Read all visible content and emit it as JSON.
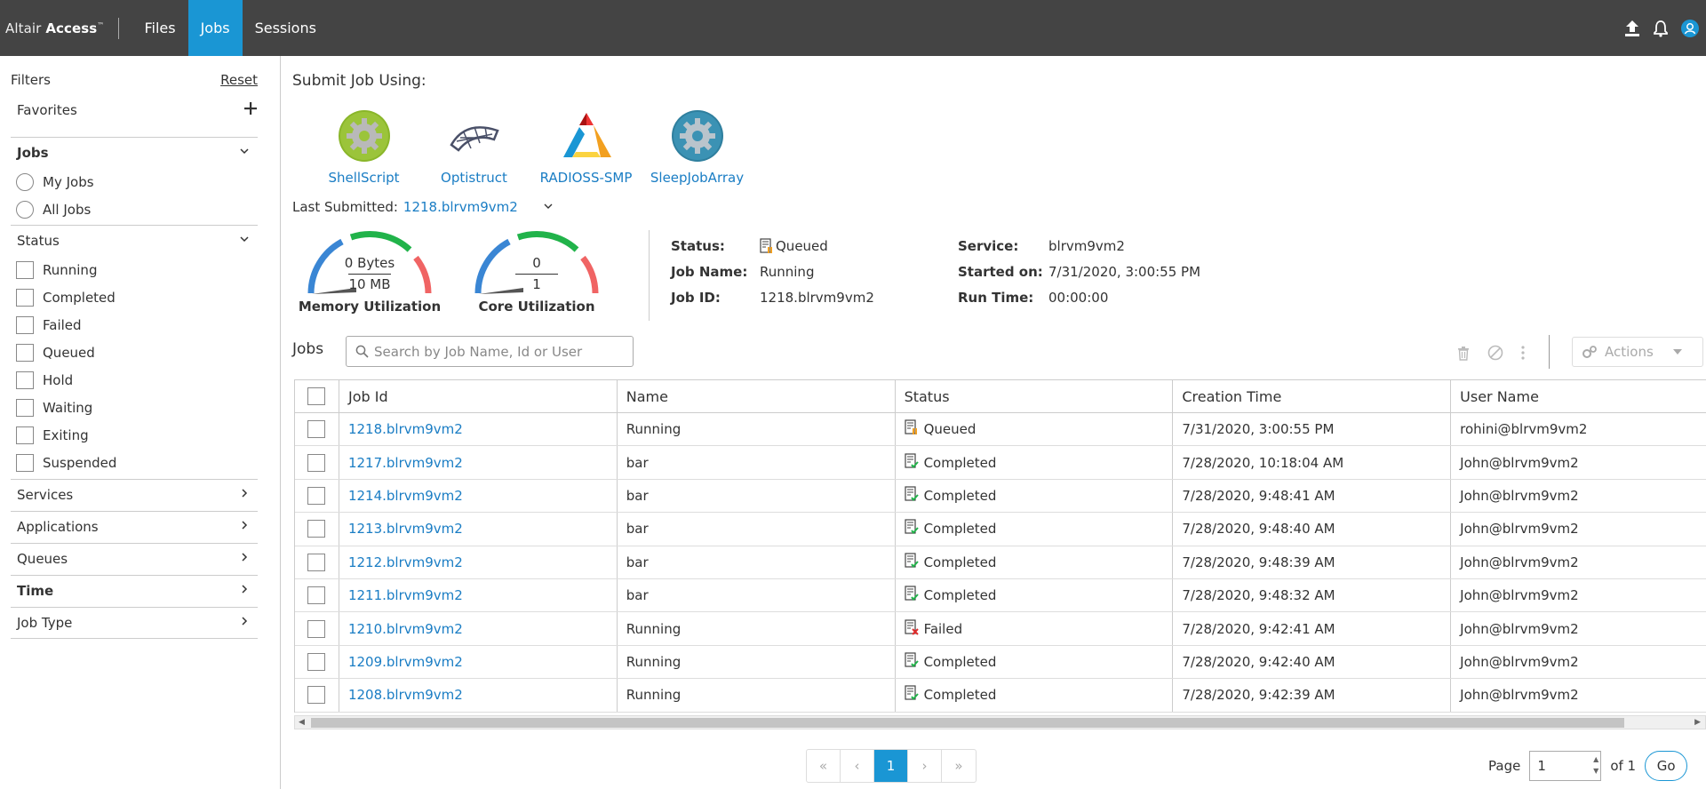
{
  "header": {
    "brand_prefix": "Altair",
    "brand_name": "Access",
    "brand_tm": "™",
    "tabs": [
      {
        "label": "Files",
        "active": false
      },
      {
        "label": "Jobs",
        "active": true
      },
      {
        "label": "Sessions",
        "active": false
      }
    ],
    "accent": "#1a96d4"
  },
  "sidebar": {
    "filters_label": "Filters",
    "reset_label": "Reset",
    "favorites_label": "Favorites",
    "jobs_section": {
      "label": "Jobs",
      "options": [
        "My Jobs",
        "All Jobs"
      ]
    },
    "status_section": {
      "label": "Status",
      "options": [
        "Running",
        "Completed",
        "Failed",
        "Queued",
        "Hold",
        "Waiting",
        "Exiting",
        "Suspended"
      ]
    },
    "collapsed_sections": [
      "Services",
      "Applications",
      "Queues",
      "Time",
      "Job Type"
    ]
  },
  "submit": {
    "title": "Submit Job Using:",
    "apps": [
      "ShellScript",
      "Optistruct",
      "RADIOSS-SMP",
      "SleepJobArray"
    ]
  },
  "last_submitted": {
    "label": "Last Submitted:",
    "job": "1218.blrvm9vm2"
  },
  "gauges": {
    "memory": {
      "used": "0 Bytes",
      "total": "10 MB",
      "label": "Memory Utilization",
      "fraction": 0
    },
    "core": {
      "used": "0",
      "total": "1",
      "label": "Core Utilization",
      "fraction": 0
    }
  },
  "details": {
    "status_label": "Status:",
    "status_value": "Queued",
    "jobname_label": "Job Name:",
    "jobname_value": "Running",
    "jobid_label": "Job ID:",
    "jobid_value": "1218.blrvm9vm2",
    "service_label": "Service:",
    "service_value": "blrvm9vm2",
    "started_label": "Started on:",
    "started_value": "7/31/2020, 3:00:55 PM",
    "runtime_label": "Run Time:",
    "runtime_value": "00:00:00"
  },
  "jobs": {
    "title": "Jobs",
    "search_placeholder": "Search by Job Name, Id or User",
    "actions_label": "Actions",
    "columns": [
      "Job Id",
      "Name",
      "Status",
      "Creation Time",
      "User Name"
    ],
    "rows": [
      {
        "id": "1218.blrvm9vm2",
        "name": "Running",
        "status": "Queued",
        "created": "7/31/2020, 3:00:55 PM",
        "user": "rohini@blrvm9vm2"
      },
      {
        "id": "1217.blrvm9vm2",
        "name": "bar",
        "status": "Completed",
        "created": "7/28/2020, 10:18:04 AM",
        "user": "John@blrvm9vm2"
      },
      {
        "id": "1214.blrvm9vm2",
        "name": "bar",
        "status": "Completed",
        "created": "7/28/2020, 9:48:41 AM",
        "user": "John@blrvm9vm2"
      },
      {
        "id": "1213.blrvm9vm2",
        "name": "bar",
        "status": "Completed",
        "created": "7/28/2020, 9:48:40 AM",
        "user": "John@blrvm9vm2"
      },
      {
        "id": "1212.blrvm9vm2",
        "name": "bar",
        "status": "Completed",
        "created": "7/28/2020, 9:48:39 AM",
        "user": "John@blrvm9vm2"
      },
      {
        "id": "1211.blrvm9vm2",
        "name": "bar",
        "status": "Completed",
        "created": "7/28/2020, 9:48:32 AM",
        "user": "John@blrvm9vm2"
      },
      {
        "id": "1210.blrvm9vm2",
        "name": "Running",
        "status": "Failed",
        "created": "7/28/2020, 9:42:41 AM",
        "user": "John@blrvm9vm2"
      },
      {
        "id": "1209.blrvm9vm2",
        "name": "Running",
        "status": "Completed",
        "created": "7/28/2020, 9:42:40 AM",
        "user": "John@blrvm9vm2"
      },
      {
        "id": "1208.blrvm9vm2",
        "name": "Running",
        "status": "Completed",
        "created": "7/28/2020, 9:42:39 AM",
        "user": "John@blrvm9vm2"
      }
    ]
  },
  "pagination": {
    "first": "«",
    "prev": "‹",
    "current": "1",
    "next": "›",
    "last": "»",
    "page_label": "Page",
    "page_value": "1",
    "of_label": "of 1",
    "go_label": "Go"
  }
}
